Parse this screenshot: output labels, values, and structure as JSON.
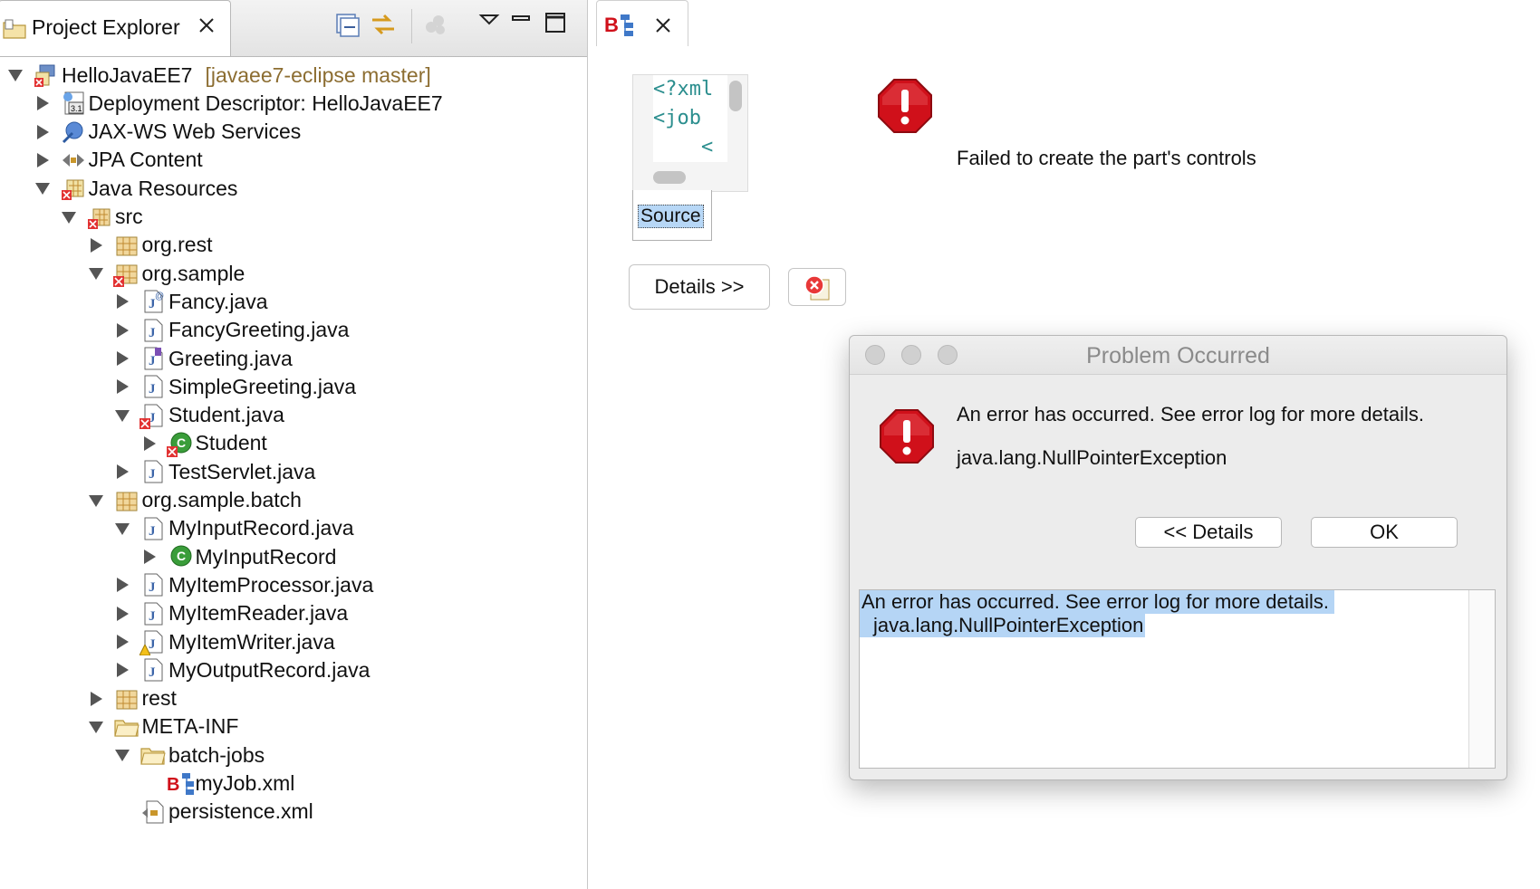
{
  "explorer": {
    "tab_label": "Project Explorer",
    "toolbar_icons": [
      "collapse-all-icon",
      "link-with-editor-icon",
      "filter-icon",
      "view-menu-icon",
      "minimize-icon",
      "maximize-icon"
    ],
    "tree": [
      {
        "label": "HelloJavaEE7",
        "extra": "[javaee7-eclipse master]",
        "icon": "project-icon",
        "expanded": true
      },
      {
        "label": "Deployment Descriptor: HelloJavaEE7",
        "icon": "deployment-descriptor-icon",
        "expanded": false
      },
      {
        "label": "JAX-WS Web Services",
        "icon": "web-services-icon",
        "expanded": false
      },
      {
        "label": "JPA Content",
        "icon": "jpa-icon",
        "expanded": false
      },
      {
        "label": "Java Resources",
        "icon": "java-resources-icon",
        "expanded": true
      },
      {
        "label": "src",
        "icon": "source-folder-icon",
        "expanded": true
      },
      {
        "label": "org.rest",
        "icon": "package-icon",
        "expanded": false
      },
      {
        "label": "org.sample",
        "icon": "package-icon",
        "expanded": true
      },
      {
        "label": "Fancy.java",
        "icon": "java-annotation-file-icon",
        "expanded": false
      },
      {
        "label": "FancyGreeting.java",
        "icon": "java-file-icon",
        "expanded": false
      },
      {
        "label": "Greeting.java",
        "icon": "java-interface-file-icon",
        "expanded": false
      },
      {
        "label": "SimpleGreeting.java",
        "icon": "java-file-icon",
        "expanded": false
      },
      {
        "label": "Student.java",
        "icon": "java-file-icon",
        "expanded": true
      },
      {
        "label": "Student",
        "icon": "class-icon",
        "expanded": false
      },
      {
        "label": "TestServlet.java",
        "icon": "java-file-icon",
        "expanded": false
      },
      {
        "label": "org.sample.batch",
        "icon": "package-icon",
        "expanded": true
      },
      {
        "label": "MyInputRecord.java",
        "icon": "java-file-icon",
        "expanded": true
      },
      {
        "label": "MyInputRecord",
        "icon": "class-icon",
        "expanded": false
      },
      {
        "label": "MyItemProcessor.java",
        "icon": "java-file-icon",
        "expanded": false
      },
      {
        "label": "MyItemReader.java",
        "icon": "java-file-icon",
        "expanded": false
      },
      {
        "label": "MyItemWriter.java",
        "icon": "java-file-icon",
        "expanded": false
      },
      {
        "label": "MyOutputRecord.java",
        "icon": "java-file-icon",
        "expanded": false
      },
      {
        "label": "rest",
        "icon": "package-icon",
        "expanded": false
      },
      {
        "label": "META-INF",
        "icon": "folder-icon",
        "expanded": true
      },
      {
        "label": "batch-jobs",
        "icon": "folder-icon",
        "expanded": true
      },
      {
        "label": "myJob.xml",
        "icon": "batch-xml-icon",
        "expanded": null
      },
      {
        "label": "persistence.xml",
        "icon": "persistence-xml-icon",
        "expanded": null
      }
    ]
  },
  "editor": {
    "tab_icon": "batch-editor-icon",
    "xml_lines": [
      "<?xml",
      "<job",
      "    <"
    ],
    "source_tab": "Source",
    "error_text": "Failed to create the part's controls",
    "details_button": "Details >>",
    "small_button_icon": "error-log-icon"
  },
  "dialog": {
    "title": "Problem Occurred",
    "message": "An error has occurred. See error log for more details.",
    "exception": "java.lang.NullPointerException",
    "details_button": "<< Details",
    "ok_button": "OK",
    "details_line1": "An error has occurred. See error log for more details.",
    "details_line2": "java.lang.NullPointerException"
  },
  "colors": {
    "selection": "#b5d5f5",
    "error_red": "#d0101a",
    "repo_label": "#8c6d31"
  }
}
